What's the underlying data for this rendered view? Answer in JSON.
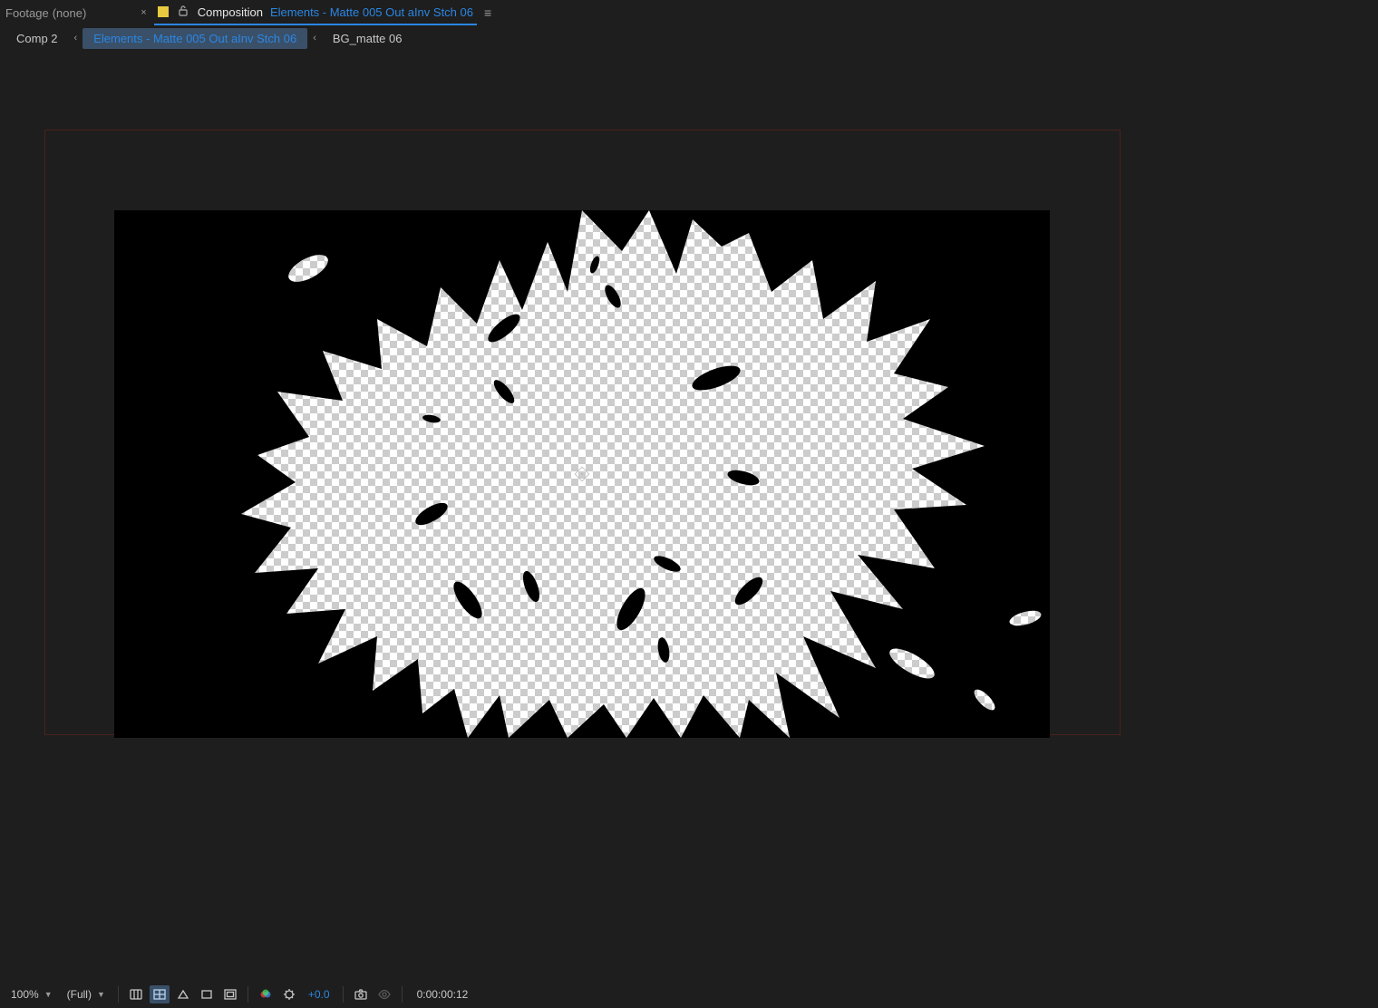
{
  "header": {
    "footage_label": "Footage",
    "footage_value": "(none)",
    "tab_close_symbol": "×",
    "composition_label": "Composition",
    "composition_name": "Elements - Matte 005 Out aInv Stch 06",
    "panel_menu_symbol": "≡"
  },
  "breadcrumbs": {
    "items": [
      "Comp 2",
      "Elements - Matte 005 Out aInv Stch 06",
      "BG_matte 06"
    ],
    "active_index": 1,
    "chevron": "‹"
  },
  "toolbar": {
    "magnification": "100%",
    "resolution": "(Full)",
    "exposure": "+0.0",
    "timecode": "0:00:00:12"
  },
  "colors": {
    "accent": "#2b86e3",
    "swatch": "#e8c940"
  }
}
